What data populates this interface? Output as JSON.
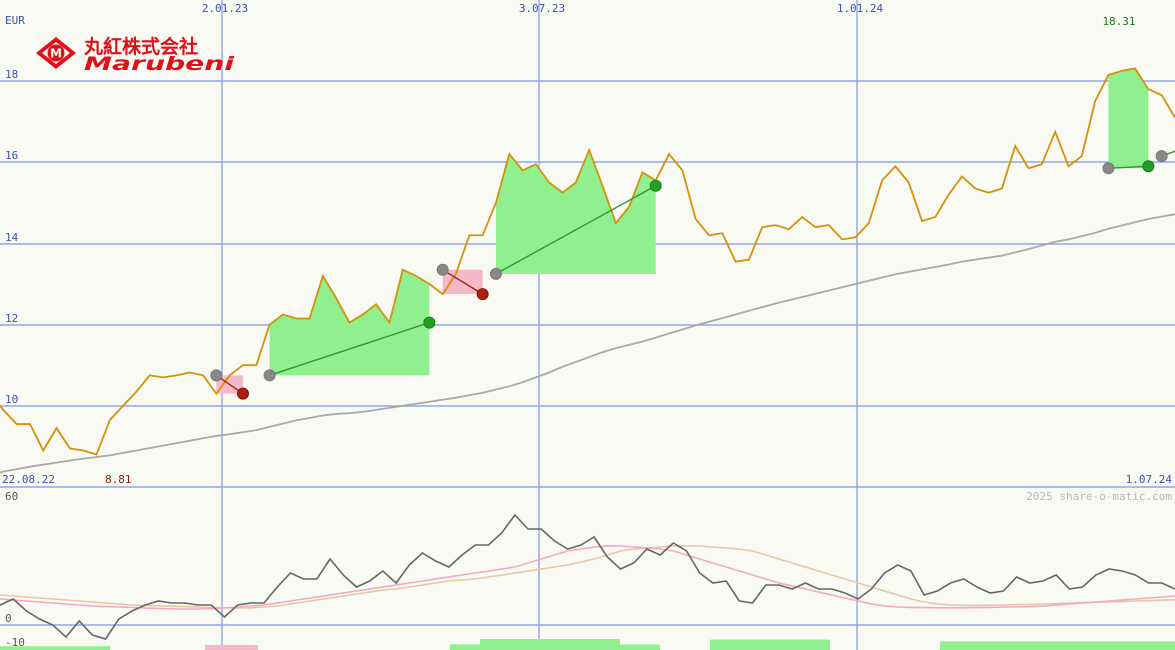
{
  "header": {
    "currency": "EUR",
    "dates_top": [
      "2.01.23",
      "3.07.23",
      "1.01.24"
    ],
    "last_value": "18.31",
    "min_value": "8.81",
    "start_date": "22.08.22",
    "end_date": "1.07.24",
    "copyright": "2025 share-o-matic.com"
  },
  "logo": {
    "name_jp": "丸紅株式会社",
    "name_en": "Marubeni",
    "mark": "M"
  },
  "colors": {
    "price": "#d4920a",
    "average": "#a8a8a8",
    "gain_fill": "#90f090",
    "loss_fill": "#f4b8c8",
    "gain_line": "#2a9a2a",
    "loss_line": "#9a2a1a",
    "grid": "#8fa8ec",
    "logo_red": "#e01018",
    "osc_main": "#666666",
    "osc_pink": "#f4a8c0",
    "osc_tan": "#e4c8a0",
    "volume": "#90f090"
  },
  "chart_data": [
    {
      "type": "line",
      "title": "",
      "ylabel": "EUR",
      "y_ticks": [
        "18",
        "16",
        "14",
        "12",
        "10"
      ],
      "ylim": [
        8.0,
        19.7
      ],
      "xlim": [
        "22.08.22",
        "1.07.24"
      ],
      "grid": true,
      "series": [
        {
          "values": [
            10.3,
            9.9,
            9.55,
            9.55,
            8.9,
            9.45,
            8.95,
            8.9,
            8.8,
            9.65,
            10.0,
            10.35,
            10.75,
            10.7,
            10.75,
            10.82,
            10.75,
            10.3,
            10.75,
            11.0,
            11.0,
            12.0,
            12.25,
            12.15,
            12.15,
            13.2,
            12.65,
            12.05,
            12.25,
            12.5,
            12.05,
            13.35,
            13.2,
            13.0,
            12.75,
            13.25,
            14.2,
            14.2,
            15.0,
            16.2,
            15.8,
            15.95,
            15.5,
            15.25,
            15.5,
            16.3,
            15.42,
            14.5,
            14.9,
            15.75,
            15.55,
            16.2,
            15.8,
            14.6,
            14.2,
            14.25,
            13.55,
            13.6,
            14.4,
            14.45,
            14.35,
            14.65,
            14.4,
            14.45,
            14.1,
            14.15,
            14.5,
            15.55,
            15.9,
            15.5,
            14.55,
            14.65,
            15.2,
            15.65,
            15.35,
            15.25,
            15.35,
            16.4,
            15.85,
            15.95,
            16.75,
            15.9,
            16.15,
            17.5,
            18.15,
            18.25,
            18.31,
            17.8,
            17.65,
            17.1
          ]
        },
        {
          "values": [
            8.3,
            8.38,
            8.44,
            8.5,
            8.55,
            8.6,
            8.65,
            8.7,
            8.74,
            8.78,
            8.84,
            8.9,
            8.96,
            9.02,
            9.08,
            9.14,
            9.2,
            9.26,
            9.3,
            9.35,
            9.4,
            9.48,
            9.56,
            9.64,
            9.7,
            9.76,
            9.8,
            9.82,
            9.85,
            9.9,
            9.95,
            10.0,
            10.05,
            10.1,
            10.15,
            10.2,
            10.26,
            10.32,
            10.4,
            10.48,
            10.58,
            10.7,
            10.82,
            10.96,
            11.08,
            11.2,
            11.32,
            11.42,
            11.5,
            11.58,
            11.68,
            11.78,
            11.88,
            11.98,
            12.07,
            12.16,
            12.25,
            12.34,
            12.43,
            12.52,
            12.6,
            12.68,
            12.76,
            12.84,
            12.92,
            13.0,
            13.08,
            13.16,
            13.24,
            13.3,
            13.36,
            13.42,
            13.48,
            13.55,
            13.6,
            13.65,
            13.7,
            13.78,
            13.86,
            13.95,
            14.04,
            14.1,
            14.18,
            14.26,
            14.36,
            14.44,
            14.52,
            14.6,
            14.66,
            14.72
          ]
        }
      ],
      "signals": [
        {
          "kind": "loss",
          "from": [
            17,
            10.75
          ],
          "to": [
            19,
            10.3
          ]
        },
        {
          "kind": "gain",
          "from": [
            21,
            10.75
          ],
          "to": [
            33,
            12.05
          ]
        },
        {
          "kind": "loss",
          "from": [
            34,
            13.35
          ],
          "to": [
            37,
            12.75
          ]
        },
        {
          "kind": "gain",
          "from": [
            38,
            13.25
          ],
          "to": [
            50,
            15.42
          ]
        },
        {
          "kind": "gain",
          "from": [
            84,
            15.85
          ],
          "to": [
            87,
            15.9
          ]
        },
        {
          "kind": "gain",
          "from": [
            88,
            16.15
          ],
          "to": [
            96,
            17.1
          ]
        }
      ]
    },
    {
      "type": "line",
      "title": "",
      "y_ticks": [
        "60",
        "0",
        "-10"
      ],
      "ylim": [
        -10,
        60
      ],
      "grid": true,
      "series": [
        {
          "values": [
            10,
            13,
            7,
            3,
            0,
            -6,
            2,
            -5,
            -7,
            3,
            7,
            10,
            12,
            11,
            11,
            10,
            10,
            4,
            10,
            11,
            11,
            19,
            26,
            23,
            23,
            33,
            25,
            19,
            22,
            27,
            21,
            30,
            36,
            32,
            29,
            35,
            40,
            40,
            46,
            55,
            48,
            48,
            42,
            38,
            40,
            44,
            34,
            28,
            31,
            38,
            35,
            41,
            37,
            26,
            21,
            22,
            12,
            11,
            20,
            20,
            18,
            21,
            18,
            18,
            16,
            13,
            18,
            26,
            30,
            27,
            15,
            17,
            21,
            23,
            19,
            16,
            17,
            24,
            21,
            22,
            25,
            18,
            19,
            25,
            28,
            27,
            25,
            21,
            21,
            18
          ]
        },
        {
          "values": [
            13,
            12.5,
            12,
            11.5,
            11,
            10.5,
            10,
            9.5,
            9.2,
            9,
            8.8,
            8.5,
            8.3,
            8.1,
            8,
            8,
            8.2,
            8.5,
            9,
            9.5,
            10,
            11,
            12,
            13,
            14,
            15,
            16,
            17,
            18,
            19,
            20,
            21,
            22,
            23,
            24,
            25,
            26,
            27,
            28,
            29,
            31,
            33,
            35,
            37,
            38,
            39,
            39.5,
            39.5,
            39,
            38.5,
            38,
            37,
            35,
            33,
            31,
            29,
            27,
            25,
            23,
            21,
            19.5,
            18,
            16.5,
            15,
            13.5,
            12,
            10.5,
            9.5,
            9,
            8.8,
            8.7,
            8.6,
            8.6,
            8.6,
            8.7,
            8.8,
            9,
            9,
            9.2,
            9.5,
            10,
            10.5,
            11,
            11.5,
            12,
            12.5,
            13,
            13.5,
            14,
            14.5
          ]
        },
        {
          "values": [
            15,
            14.5,
            14,
            13.5,
            13,
            12.5,
            12,
            11.5,
            11,
            10.5,
            10,
            9.8,
            9.6,
            9.4,
            9.2,
            9,
            8.8,
            8.6,
            8.5,
            8.6,
            9,
            9.5,
            10.5,
            11.5,
            12.5,
            13.5,
            14.5,
            15.5,
            16.5,
            17.5,
            18,
            19,
            20,
            21,
            22,
            22.5,
            23,
            24,
            25,
            26,
            27,
            28,
            29,
            30,
            31.5,
            33,
            35,
            37,
            38,
            38.5,
            39,
            39.5,
            39.5,
            39.5,
            39,
            38.5,
            38,
            37,
            35,
            33,
            31,
            29,
            27,
            25,
            23,
            21,
            19,
            17,
            15,
            13,
            11.5,
            10.5,
            10,
            9.8,
            9.8,
            9.9,
            10,
            10.2,
            10.3,
            10.5,
            10.7,
            11,
            11.2,
            11.4,
            11.6,
            11.8,
            12,
            12.2,
            12.4,
            12.6
          ]
        }
      ],
      "volume": [
        {
          "kind": "gain",
          "level": 0.15
        },
        {
          "kind": "loss",
          "level": 0.25
        },
        {
          "kind": "gain",
          "level": 0.3
        },
        {
          "kind": "gain",
          "level": 0.75
        },
        {
          "kind": "gain",
          "level": 0.7
        },
        {
          "kind": "gain",
          "level": 0.55
        }
      ]
    }
  ]
}
